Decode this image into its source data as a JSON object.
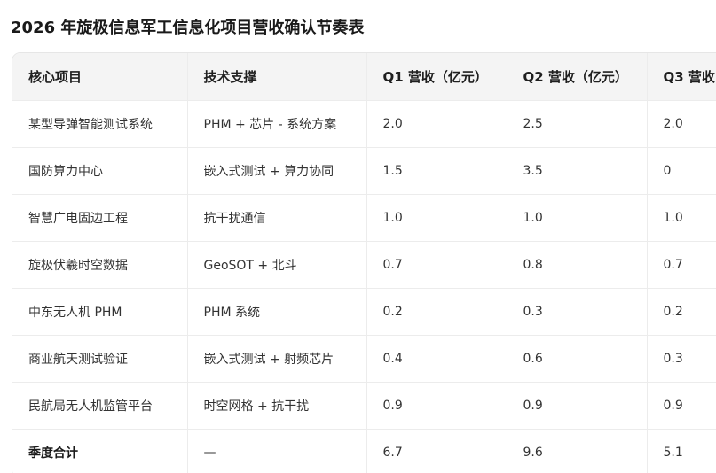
{
  "title": "2026 年旋极信息军工信息化项目营收确认节奏表",
  "table": {
    "headers": [
      "核心项目",
      "技术支撑",
      "Q1 营收（亿元）",
      "Q2 营收（亿元）",
      "Q3 营收"
    ],
    "rows": [
      [
        "某型导弹智能测试系统",
        "PHM + 芯片 - 系统方案",
        "2.0",
        "2.5",
        "2.0"
      ],
      [
        "国防算力中心",
        "嵌入式测试 + 算力协同",
        "1.5",
        "3.5",
        "0"
      ],
      [
        "智慧广电固边工程",
        "抗干扰通信",
        "1.0",
        "1.0",
        "1.0"
      ],
      [
        "旋极伏羲时空数据",
        "GeoSOT + 北斗",
        "0.7",
        "0.8",
        "0.7"
      ],
      [
        "中东无人机 PHM",
        "PHM 系统",
        "0.2",
        "0.3",
        "0.2"
      ],
      [
        "商业航天测试验证",
        "嵌入式测试 + 射频芯片",
        "0.4",
        "0.6",
        "0.3"
      ],
      [
        "民航局无人机监管平台",
        "时空网格 + 抗干扰",
        "0.9",
        "0.9",
        "0.9"
      ]
    ],
    "total": [
      "季度合计",
      "—",
      "6.7",
      "9.6",
      "5.1"
    ]
  }
}
